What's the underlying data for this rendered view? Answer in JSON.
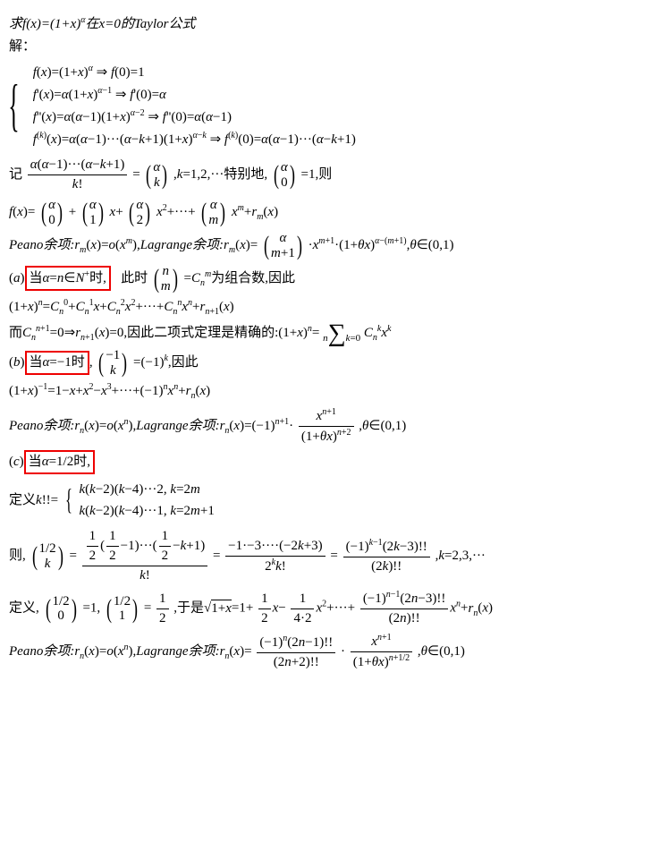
{
  "title": "求f(x)=(1+x)^α在x=0的Taylor公式",
  "solLabel": "解：",
  "deriv": {
    "l1": "f(x)=(1+x)^α ⇒ f(0)=1",
    "l2": "f'(x)=α(1+x)^{α−1} ⇒ f'(0)=α",
    "l3": "f''(x)=α(α−1)(1+x)^{α−2} ⇒ f''(0)=α(α−1)",
    "l4": "f^{(k)}(x)=α(α−1)···(α−k+1)(1+x)^{α−k} ⇒ f^{(k)}(0)=α(α−1)···(α−k+1)"
  },
  "def_binom": {
    "prefix": "记",
    "num": "α(α−1)···(α−k+1)",
    "den": "k!",
    "eq": "=",
    "b_top": "α",
    "b_bot": "k",
    "after": ",k=1,2,···特别地,",
    "b2_top": "α",
    "b2_bot": "0",
    "tail": "=1,则"
  },
  "fx_expand": {
    "prefix": "f(x)=",
    "t0_top": "α",
    "t0_bot": "0",
    "plus1": "+",
    "t1_top": "α",
    "t1_bot": "1",
    "x1": "x+",
    "t2_top": "α",
    "t2_bot": "2",
    "x2": "x^2+···+",
    "tm_top": "α",
    "tm_bot": "m",
    "xm": "x^m+r_m(x)"
  },
  "peano_lag1": {
    "peano_lbl": "Peano余项:",
    "peano_eq": "r_m(x)=o(x^m),",
    "lag_lbl": "Lagrange余项:",
    "lag_pre": "r_m(x)=",
    "b_top": "α",
    "b_bot": "m+1",
    "lag_post": "·x^{m+1}·(1+θx)^{α−(m+1)},θ∈(0,1)"
  },
  "case_a": {
    "tag": "(a)",
    "box": "当α=n∈N^+时,",
    "mid": "  此时",
    "b_top": "n",
    "b_bot": "m",
    "after": "=C_n^m为组合数,因此"
  },
  "case_a_exp": "(1+x)^n=C_n^0+C_n^1x+C_n^2x^2+···+C_n^nx^n+r_{n+1}(x)",
  "case_a_exact": {
    "pre": "而C_n^{n+1}=0⇒r_{n+1}(x)=0,因此二项式定理是精确的:(1+x)^n=",
    "sum_top": "n",
    "sum_bot": "k=0",
    "sum_body": "C_n^kx^k"
  },
  "case_b": {
    "tag": "(b)",
    "box": "当α=−1时",
    "comma": ",",
    "b_top": "−1",
    "b_bot": "k",
    "after": "=(−1)^k,因此"
  },
  "case_b_exp": "(1+x)^{−1}=1−x+x^2−x^3+···+(−1)^nx^n+r_n(x)",
  "case_b_rem": {
    "peano_lbl": "Peano余项:",
    "peano_eq": "r_n(x)=o(x^n),",
    "lag_lbl": "Lagrange余项:",
    "lag_pre": "r_n(x)=(−1)^{n+1}·",
    "num": "x^{n+1}",
    "den": "(1+θx)^{n+2}",
    "tail": ",θ∈(0,1)"
  },
  "case_c": {
    "tag": "(c)",
    "box": "当α=1/2时,"
  },
  "dfact": {
    "pre": "定义k!!=",
    "l1": "k(k−2)(k−4)···2, k=2m",
    "l2": "k(k−2)(k−4)···1, k=2m+1"
  },
  "half_binom": {
    "pre": "则,",
    "b_top": "1/2",
    "b_bot": "k",
    "eq": "=",
    "num1_a": "1",
    "num1_b": "2",
    "num1_c": "1",
    "num1_d": "2",
    "num1_mid": "−1)···(",
    "num1_e": "1",
    "num1_f": "2",
    "num1_tail": "−k+1)",
    "den1": "k!",
    "eq2": "=",
    "num2": "−1·−3····(−2k+3)",
    "den2": "2^kk!",
    "eq3": "=",
    "num3": "(−1)^{k−1}(2k−3)!!",
    "den3": "(2k)!!",
    "tail": ",k=2,3,···"
  },
  "half_def": {
    "pre": "定义,",
    "b1_top": "1/2",
    "b1_bot": "0",
    "mid1": "=1,",
    "b2_top": "1/2",
    "b2_bot": "1",
    "mid2": "=",
    "num": "1",
    "den": "2",
    "sqrt_pre": ",于是",
    "sqrt_body": "1+x",
    "expand": "=1+",
    "t1n": "1",
    "t1d": "2",
    "t1x": "x−",
    "t2n": "1",
    "t2d": "4·2",
    "t2x": "x^2+···+",
    "tnN": "(−1)^{n−1}(2n−3)!!",
    "tnD": "(2n)!!",
    "tnx": "x^n+r_n(x)"
  },
  "half_rem": {
    "peano_lbl": "Peano余项:",
    "peano_eq": "r_n(x)=o(x^n),",
    "lag_lbl": "Lagrange余项:",
    "lag_pre": "r_n(x)=",
    "num1": "(−1)^n(2n−1)!!",
    "den1": "(2n+2)!!",
    "dot": "·",
    "num2": "x^{n+1}",
    "den2": "(1+θx)^{n+1/2}",
    "tail": ",θ∈(0,1)"
  }
}
